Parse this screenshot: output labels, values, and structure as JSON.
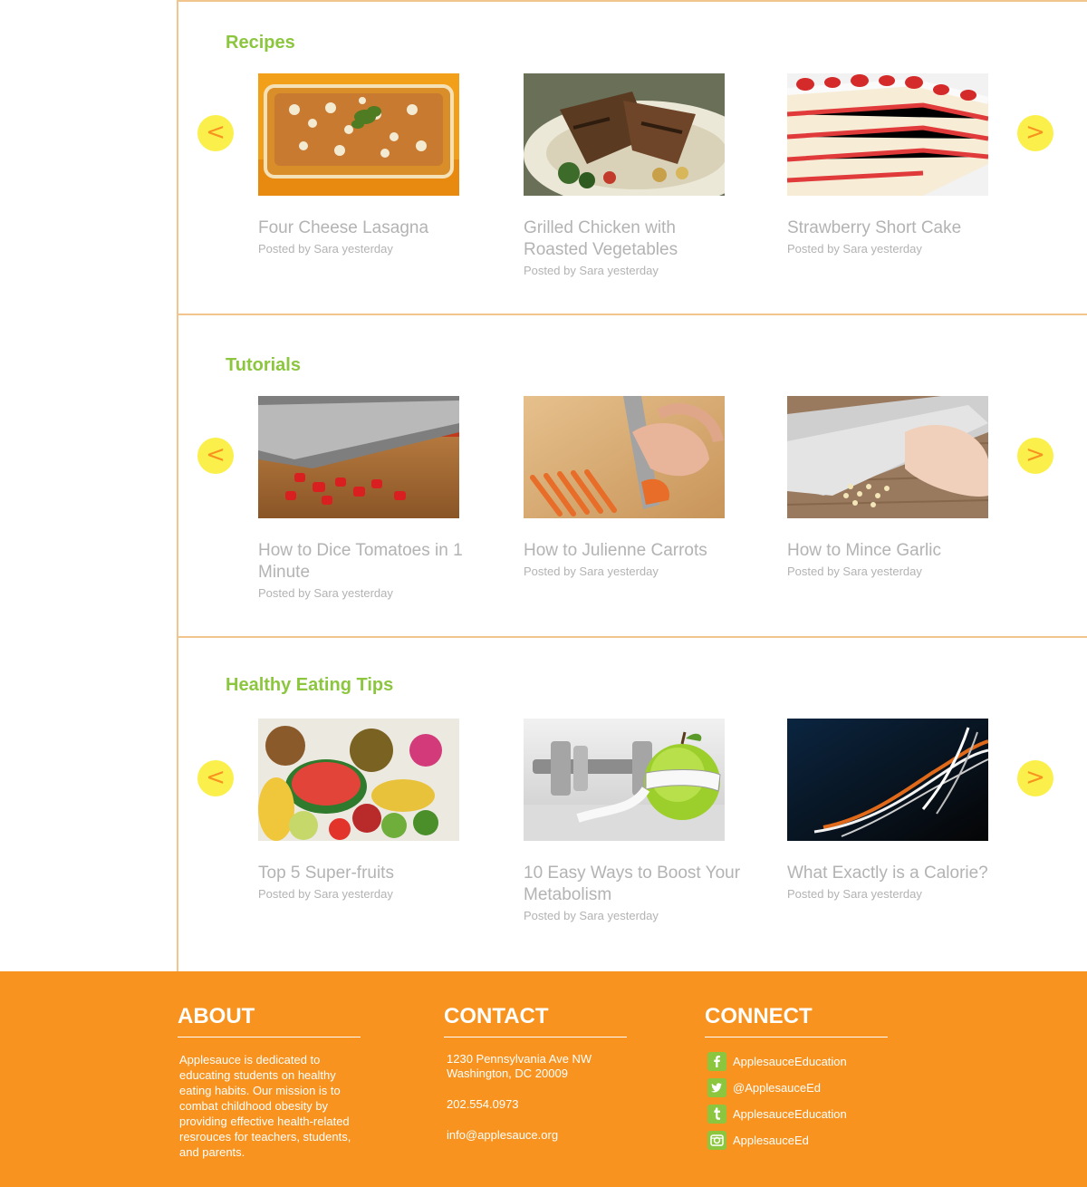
{
  "sections": [
    {
      "title": "Recipes",
      "prev_arrow": "<",
      "next_arrow": ">",
      "cards": [
        {
          "title": "Four Cheese Lasagna",
          "meta": "Posted by Sara yesterday"
        },
        {
          "title": "Grilled Chicken with Roasted Vegetables",
          "meta": "Posted by Sara yesterday"
        },
        {
          "title": "Strawberry Short Cake",
          "meta": "Posted by Sara yesterday"
        }
      ]
    },
    {
      "title": "Tutorials",
      "prev_arrow": "<",
      "next_arrow": ">",
      "cards": [
        {
          "title": "How to Dice Tomatoes in 1 Minute",
          "meta": "Posted by Sara yesterday"
        },
        {
          "title": "How to Julienne Carrots",
          "meta": "Posted by Sara yesterday"
        },
        {
          "title": "How to Mince Garlic",
          "meta": "Posted by Sara yesterday"
        }
      ]
    },
    {
      "title": "Healthy Eating Tips",
      "prev_arrow": "<",
      "next_arrow": ">",
      "cards": [
        {
          "title": "Top 5 Super-fruits",
          "meta": "Posted by Sara yesterday"
        },
        {
          "title": "10 Easy Ways to Boost Your Metabolism",
          "meta": "Posted by Sara yesterday"
        },
        {
          "title": "What Exactly is a Calorie?",
          "meta": "Posted by Sara yesterday"
        }
      ]
    }
  ],
  "footer": {
    "about": {
      "heading": "ABOUT",
      "text": "Applesauce is dedicated to educating students on healthy eating habits. Our mission is to combat childhood obesity by providing effective health-related resrouces for teachers, students, and parents."
    },
    "contact": {
      "heading": "CONTACT",
      "address_line1": "1230 Pennsylvania Ave NW",
      "address_line2": "Washington, DC 20009",
      "phone": "202.554.0973",
      "email": "info@applesauce.org"
    },
    "connect": {
      "heading": "CONNECT",
      "links": [
        {
          "icon": "facebook-icon",
          "label": "ApplesauceEducation"
        },
        {
          "icon": "twitter-icon",
          "label": "@ApplesauceEd"
        },
        {
          "icon": "tumblr-icon",
          "label": "ApplesauceEducation"
        },
        {
          "icon": "instagram-icon",
          "label": "ApplesauceEd"
        }
      ]
    }
  },
  "colors": {
    "accent_green": "#8cc63f",
    "footer_orange": "#f7931e",
    "arrow_yellow": "#fbf04b",
    "divider": "#f3c58e",
    "muted_text": "#b3b3b3"
  }
}
